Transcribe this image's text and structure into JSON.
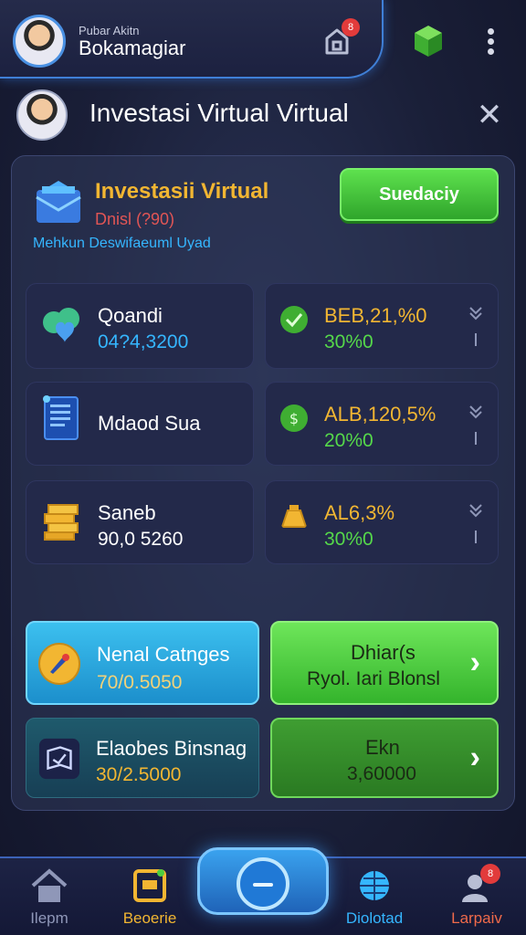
{
  "header": {
    "username_small": "Pubar Akitn",
    "username": "Bokamagiar",
    "notification_count": "8",
    "icons": [
      "notification-bell-icon",
      "green-cube-icon",
      "more-vert-icon"
    ]
  },
  "page": {
    "title": "Investasi Virtual Virtual"
  },
  "hero": {
    "title": "Investasii Virtual",
    "subtitle": "Dnisl (?90)",
    "description": "Mehkun Deswifaeuml Uyad",
    "button_label": "Suedaciy"
  },
  "assets": [
    {
      "name": "Qoandi",
      "value": "04?4,3200",
      "icon": "cloud-heart-icon"
    },
    {
      "name": "Mdaod Sua",
      "value": "",
      "icon": "document-icon"
    },
    {
      "name": "Saneb",
      "value": "90,0 5260",
      "icon": "gold-bars-icon"
    }
  ],
  "rates": [
    {
      "name": "BEB,21,%0",
      "value": "30%0",
      "icon": "green-check-coin-icon"
    },
    {
      "name": "ALB,120,5%",
      "value": "20%0",
      "icon": "green-money-coin-icon"
    },
    {
      "name": "AL6,3%",
      "value": "30%0",
      "icon": "gold-bag-icon"
    }
  ],
  "actions": [
    {
      "title": "Nenal Catnges",
      "value": "70/0.5050",
      "icon": "rocket-coin-icon"
    },
    {
      "title": "Dhiar(s",
      "value": "Ryol. Iari Blonsl",
      "icon": "chevron-right-icon"
    },
    {
      "title": "Elaobes Binsnag",
      "value": "30/2.5000",
      "icon": "book-icon"
    },
    {
      "title": "Ekn",
      "value": "3,60000",
      "icon": "chevron-right-icon"
    }
  ],
  "nav": {
    "items": [
      {
        "label": "Ilepm",
        "icon": "home-icon",
        "color": "#8f97b8"
      },
      {
        "label": "Beoerie",
        "icon": "wallet-icon",
        "color": "#f2b632"
      },
      {
        "label": "Diolotad",
        "icon": "globe-icon",
        "color": "#35b6ff"
      },
      {
        "label": "Larpaiv",
        "icon": "profile-icon",
        "color": "#f06a4a"
      }
    ],
    "center_icon": "minus-circle-icon",
    "profile_badge": "8"
  },
  "colors": {
    "accent_green": "#4ccd3f",
    "accent_blue": "#35b6ff",
    "accent_gold": "#f2b632",
    "danger_red": "#e23b3b"
  }
}
